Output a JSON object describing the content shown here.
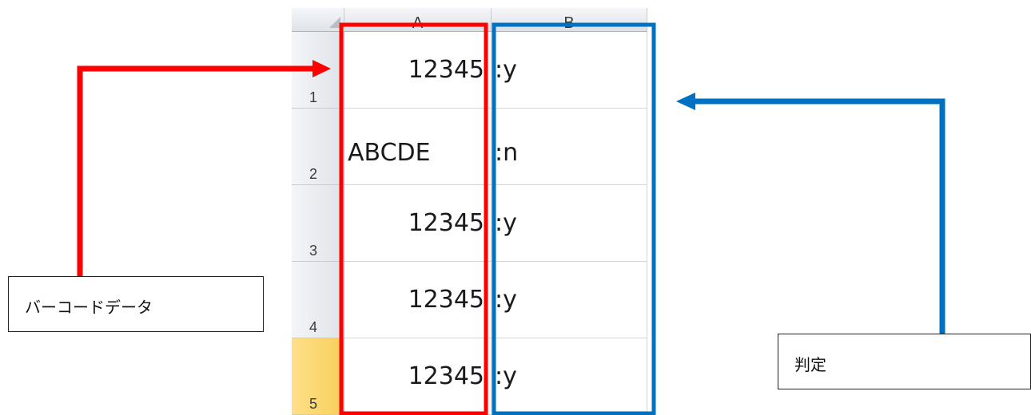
{
  "spreadsheet": {
    "columns": [
      "A",
      "B"
    ],
    "rows": [
      {
        "number": "1",
        "a": "12345",
        "b": ":y",
        "a_align": "num"
      },
      {
        "number": "2",
        "a": "ABCDE",
        "b": ":n",
        "a_align": "text"
      },
      {
        "number": "3",
        "a": "12345",
        "b": ":y",
        "a_align": "num"
      },
      {
        "number": "4",
        "a": "12345",
        "b": ":y",
        "a_align": "num"
      },
      {
        "number": "5",
        "a": "12345",
        "b": ":y",
        "a_align": "num",
        "selected": true
      }
    ]
  },
  "annotations": {
    "barcode_label": "バーコードデータ",
    "judgment_label": "判定",
    "barcode_color": "#ff0000",
    "judgment_color": "#0070c0"
  }
}
